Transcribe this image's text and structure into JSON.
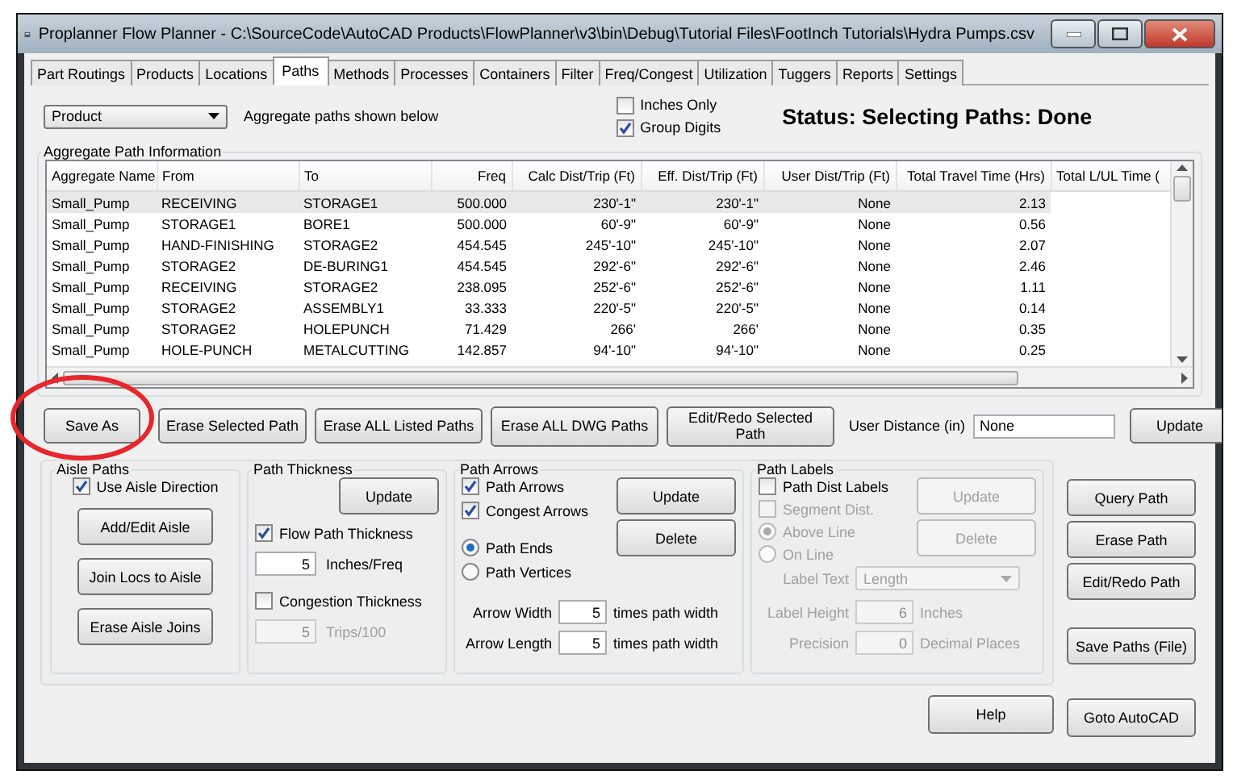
{
  "window": {
    "title": "Proplanner Flow Planner - C:\\SourceCode\\AutoCAD Products\\FlowPlanner\\v3\\bin\\Debug\\Tutorial Files\\FootInch Tutorials\\Hydra Pumps.csv"
  },
  "tabs": [
    {
      "label": "Part Routings",
      "selected": false
    },
    {
      "label": "Products",
      "selected": false
    },
    {
      "label": "Locations",
      "selected": false
    },
    {
      "label": "Paths",
      "selected": true
    },
    {
      "label": "Methods",
      "selected": false
    },
    {
      "label": "Processes",
      "selected": false
    },
    {
      "label": "Containers",
      "selected": false
    },
    {
      "label": "Filter",
      "selected": false
    },
    {
      "label": "Freq/Congest",
      "selected": false
    },
    {
      "label": "Utilization",
      "selected": false
    },
    {
      "label": "Tuggers",
      "selected": false
    },
    {
      "label": "Reports",
      "selected": false
    },
    {
      "label": "Settings",
      "selected": false
    }
  ],
  "aggregate_select": {
    "value": "Product"
  },
  "aggregate_note": "Aggregate paths shown below",
  "options": [
    {
      "label": "Inches Only",
      "checked": false
    },
    {
      "label": "Group Digits",
      "checked": true
    }
  ],
  "status": "Status:  Selecting Paths: Done",
  "aggregate_group": {
    "title": "Aggregate Path Information",
    "columns": [
      "Aggregate Name",
      "From",
      "To",
      "Freq",
      "Calc Dist/Trip (Ft)",
      "Eff. Dist/Trip (Ft)",
      "User Dist/Trip (Ft)",
      "Total Travel Time (Hrs)",
      "Total L/UL Time ("
    ],
    "rows": [
      {
        "selected": true,
        "cells": [
          "Small_Pump",
          "RECEIVING",
          "STORAGE1",
          "500.000",
          "230'-1\"",
          "230'-1\"",
          "None",
          "2.13"
        ]
      },
      {
        "selected": false,
        "cells": [
          "Small_Pump",
          "STORAGE1",
          "BORE1",
          "500.000",
          "60'-9\"",
          "60'-9\"",
          "None",
          "0.56"
        ]
      },
      {
        "selected": false,
        "cells": [
          "Small_Pump",
          "HAND-FINISHING",
          "STORAGE2",
          "454.545",
          "245'-10\"",
          "245'-10\"",
          "None",
          "2.07"
        ]
      },
      {
        "selected": false,
        "cells": [
          "Small_Pump",
          "STORAGE2",
          "DE-BURING1",
          "454.545",
          "292'-6\"",
          "292'-6\"",
          "None",
          "2.46"
        ]
      },
      {
        "selected": false,
        "cells": [
          "Small_Pump",
          "RECEIVING",
          "STORAGE2",
          "238.095",
          "252'-6\"",
          "252'-6\"",
          "None",
          "1.11"
        ]
      },
      {
        "selected": false,
        "cells": [
          "Small_Pump",
          "STORAGE2",
          "ASSEMBLY1",
          "33.333",
          "220'-5\"",
          "220'-5\"",
          "None",
          "0.14"
        ]
      },
      {
        "selected": false,
        "cells": [
          "Small_Pump",
          "STORAGE2",
          "HOLEPUNCH",
          "71.429",
          "266'",
          "266'",
          "None",
          "0.35"
        ]
      },
      {
        "selected": false,
        "cells": [
          "Small_Pump",
          "HOLE-PUNCH",
          "METALCUTTING",
          "142.857",
          "94'-10\"",
          "94'-10\"",
          "None",
          "0.25"
        ]
      }
    ]
  },
  "action_buttons": [
    "Save As",
    "Erase Selected Path",
    "Erase ALL Listed Paths",
    "Erase ALL DWG Paths",
    "Edit/Redo Selected Path"
  ],
  "user_distance": {
    "label": "User Distance (in)",
    "value": "None",
    "button": "Update"
  },
  "aisle_paths": {
    "title": "Aisle Paths",
    "checkbox": {
      "label": "Use Aisle Direction",
      "checked": true
    },
    "buttons": [
      "Add/Edit Aisle",
      "Join Locs to Aisle",
      "Erase Aisle Joins"
    ]
  },
  "path_thickness": {
    "title": "Path Thickness",
    "button": "Update",
    "flow": {
      "label": "Flow Path Thickness",
      "checked": true,
      "value": "5",
      "unit": "Inches/Freq",
      "disabled": false
    },
    "congestion": {
      "label": "Congestion Thickness",
      "checked": false,
      "value": "5",
      "unit": "Trips/100",
      "disabled": true
    }
  },
  "path_arrows": {
    "title": "Path Arrows",
    "checkboxes": [
      {
        "label": "Path Arrows",
        "checked": true
      },
      {
        "label": "Congest Arrows",
        "checked": true
      }
    ],
    "radios": [
      {
        "label": "Path Ends",
        "selected": true
      },
      {
        "label": "Path Vertices",
        "selected": false
      }
    ],
    "buttons": [
      {
        "label": "Update",
        "disabled": false
      },
      {
        "label": "Delete",
        "disabled": false
      }
    ],
    "fields": [
      {
        "label": "Arrow Width",
        "value": "5",
        "unit": "times path width"
      },
      {
        "label": "Arrow Length",
        "value": "5",
        "unit": "times path width"
      }
    ]
  },
  "path_labels": {
    "title": "Path Labels",
    "checkboxes": [
      {
        "label": "Path Dist Labels",
        "checked": false,
        "disabled": false
      },
      {
        "label": "Segment Dist.",
        "checked": false,
        "disabled": true
      }
    ],
    "radios": [
      {
        "label": "Above Line",
        "selected": true,
        "disabled": true
      },
      {
        "label": "On Line",
        "selected": false,
        "disabled": true
      }
    ],
    "buttons": [
      {
        "label": "Update",
        "disabled": true
      },
      {
        "label": "Delete",
        "disabled": true
      }
    ],
    "label_text": {
      "label": "Label Text",
      "value": "Length",
      "disabled": true
    },
    "fields": [
      {
        "label": "Label Height",
        "value": "6",
        "unit": "Inches",
        "disabled": true
      },
      {
        "label": "Precision",
        "value": "0",
        "unit": "Decimal Places",
        "disabled": true
      }
    ]
  },
  "side_buttons": [
    "Query Path",
    "Erase Path",
    "Edit/Redo Path",
    "Save Paths (File)"
  ],
  "bottom_buttons": [
    "Help",
    "Goto AutoCAD"
  ]
}
